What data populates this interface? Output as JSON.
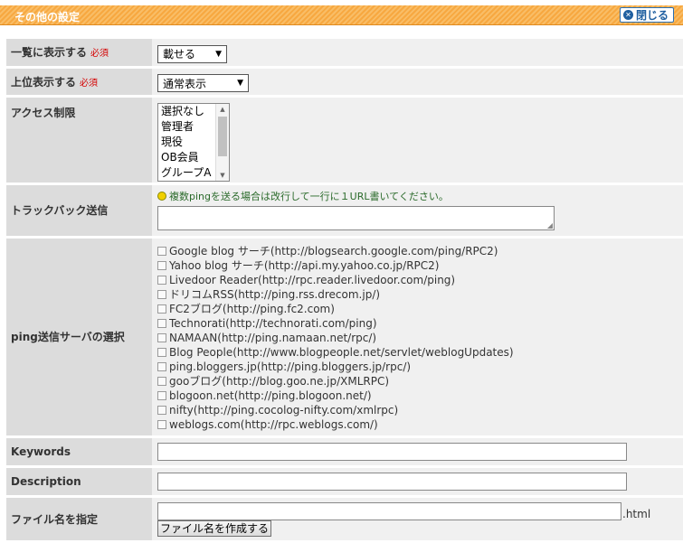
{
  "header": {
    "title": "その他の設定",
    "close_label": "閉じる"
  },
  "fields": {
    "list_display": {
      "label": "一覧に表示する",
      "required": "必須",
      "value": "載せる"
    },
    "top_display": {
      "label": "上位表示する",
      "required": "必須",
      "value": "通常表示"
    },
    "access": {
      "label": "アクセス制限",
      "options": [
        "選択なし",
        "管理者",
        "現役",
        "OB会員",
        "グループA"
      ]
    },
    "trackback": {
      "label": "トラックバック送信",
      "hint": "複数pingを送る場合は改行して一行に１URL書いてください。"
    },
    "ping": {
      "label": "ping送信サーバの選択",
      "servers": [
        "Google blog サーチ(http://blogsearch.google.com/ping/RPC2)",
        "Yahoo blog サーチ(http://api.my.yahoo.co.jp/RPC2)",
        "Livedoor Reader(http://rpc.reader.livedoor.com/ping)",
        "ドリコムRSS(http://ping.rss.drecom.jp/)",
        "FC2ブログ(http://ping.fc2.com)",
        "Technorati(http://technorati.com/ping)",
        "NAMAAN(http://ping.namaan.net/rpc/)",
        "Blog People(http://www.blogpeople.net/servlet/weblogUpdates)",
        "ping.bloggers.jp(http://ping.bloggers.jp/rpc/)",
        "gooブログ(http://blog.goo.ne.jp/XMLRPC)",
        "blogoon.net(http://ping.blogoon.net/)",
        "nifty(http://ping.cocolog-nifty.com/xmlrpc)",
        "weblogs.com(http://rpc.weblogs.com/)"
      ]
    },
    "keywords": {
      "label": "Keywords"
    },
    "description": {
      "label": "Description"
    },
    "filename": {
      "label": "ファイル名を指定",
      "ext": ".html",
      "button": "ファイル名を作成する"
    }
  }
}
